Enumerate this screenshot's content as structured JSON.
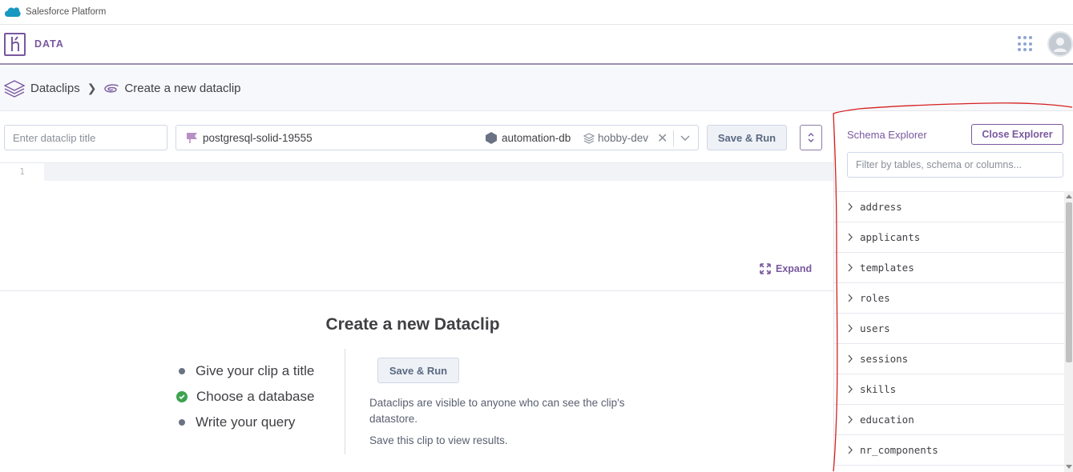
{
  "platform": {
    "label": "Salesforce Platform"
  },
  "header": {
    "app_title": "DATA"
  },
  "breadcrumb": {
    "root": "Dataclips",
    "current": "Create a new dataclip"
  },
  "toolbar": {
    "title_placeholder": "Enter dataclip title",
    "database": "postgresql-solid-19555",
    "app": "automation-db",
    "plan": "hobby-dev",
    "save_run_label": "Save & Run"
  },
  "editor": {
    "line_number": "1",
    "expand_label": "Expand"
  },
  "empty_state": {
    "title": "Create a new Dataclip",
    "steps": [
      {
        "label": "Give your clip a title",
        "done": false
      },
      {
        "label": "Choose a database",
        "done": true
      },
      {
        "label": "Write your query",
        "done": false
      }
    ],
    "save_run_label": "Save & Run",
    "note_visibility": "Dataclips are visible to anyone who can see the clip's datastore.",
    "note_save": "Save this clip to view results."
  },
  "explorer": {
    "title": "Schema Explorer",
    "close_label": "Close Explorer",
    "filter_placeholder": "Filter by tables, schema or columns...",
    "tables": [
      "address",
      "applicants",
      "templates",
      "roles",
      "users",
      "sessions",
      "skills",
      "education",
      "nr_components"
    ]
  },
  "colors": {
    "accent": "#79589f",
    "success": "#3ca34f",
    "annotation": "#d62020"
  }
}
